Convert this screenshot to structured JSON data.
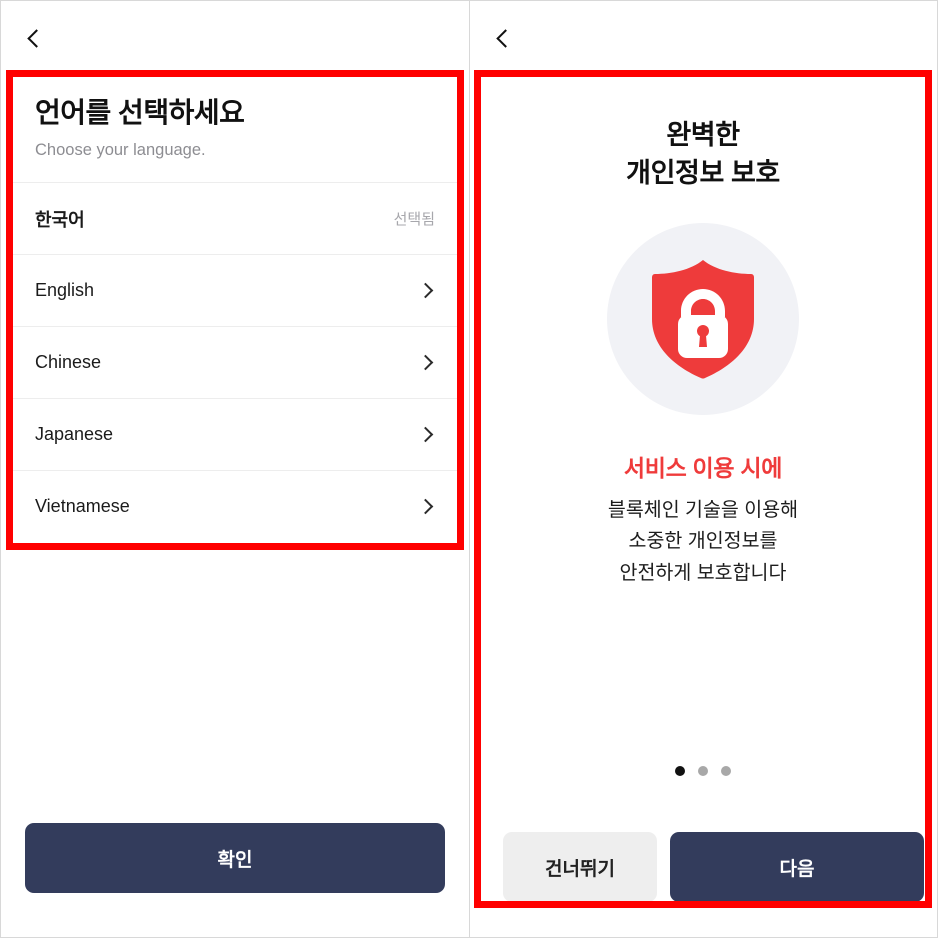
{
  "colors": {
    "annotation_red": "#ff0000",
    "primary_button": "#333c5c",
    "secondary_button": "#eeeeee",
    "accent_red": "#ef3b3b",
    "art_circle_bg": "#f1f2f6",
    "muted_text": "#8d8d92"
  },
  "left_panel": {
    "back_icon": "chevron-left-icon",
    "title": "언어를 선택하세요",
    "subtitle": "Choose your language.",
    "languages": [
      {
        "name": "한국어",
        "status": "선택됨",
        "selected": true,
        "chevron": false
      },
      {
        "name": "English",
        "status": "",
        "selected": false,
        "chevron": true
      },
      {
        "name": "Chinese",
        "status": "",
        "selected": false,
        "chevron": true
      },
      {
        "name": "Japanese",
        "status": "",
        "selected": false,
        "chevron": true
      },
      {
        "name": "Vietnamese",
        "status": "",
        "selected": false,
        "chevron": true
      }
    ],
    "confirm_button": "확인"
  },
  "right_panel": {
    "back_icon": "chevron-left-icon",
    "title_line1": "완벽한",
    "title_line2": "개인정보 보호",
    "art_icon": "shield-lock-icon",
    "highlight": "서비스 이용 시에",
    "body_line1": "블록체인 기술을 이용해",
    "body_line2": "소중한 개인정보를",
    "body_line3": "안전하게 보호합니다",
    "pagination": {
      "total": 3,
      "active_index": 0
    },
    "skip_button": "건너뛰기",
    "next_button": "다음"
  }
}
